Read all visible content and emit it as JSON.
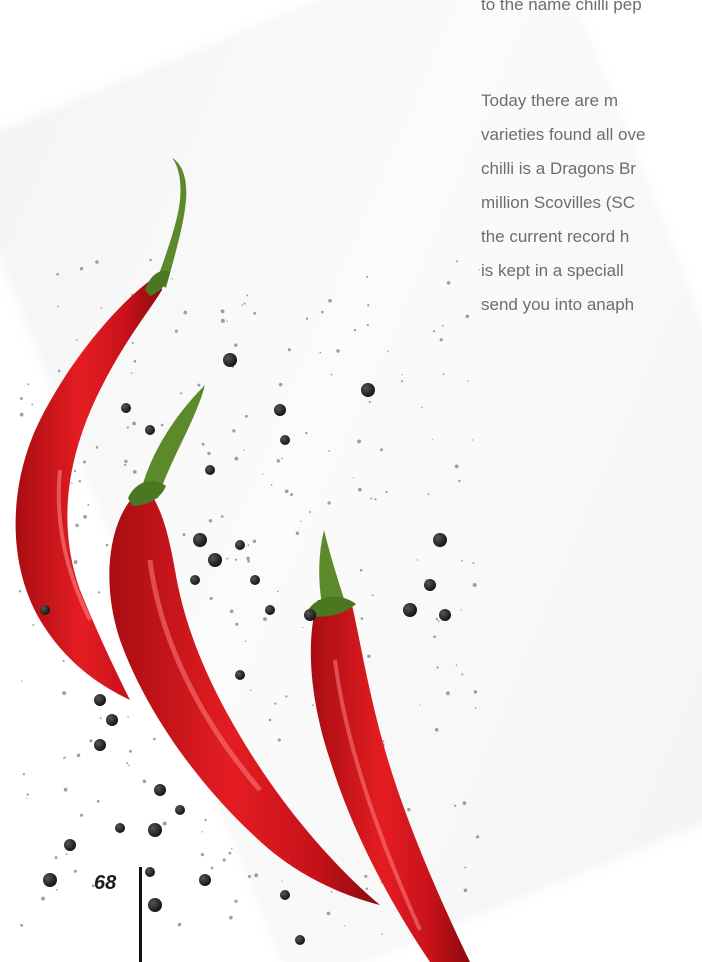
{
  "top_line": "to the name chilli pep",
  "paragraph_lines": [
    "Today there are m",
    "varieties found all ove",
    "chilli is a Dragons Br",
    "million Scovilles (SC",
    "the current record h",
    "is kept in a speciall",
    "send you into anaph"
  ],
  "page_number": "68",
  "colors": {
    "text": "#6d6d6d",
    "chilli_red": "#d4141c",
    "stem_green": "#5c8a2a",
    "pepper_black": "#1a1a1a",
    "page_number": "#1b1b1b"
  },
  "photo": {
    "subject_icons": [
      "red-chilli-pepper",
      "red-chilli-pepper",
      "red-chilli-pepper",
      "black-peppercorn"
    ]
  }
}
